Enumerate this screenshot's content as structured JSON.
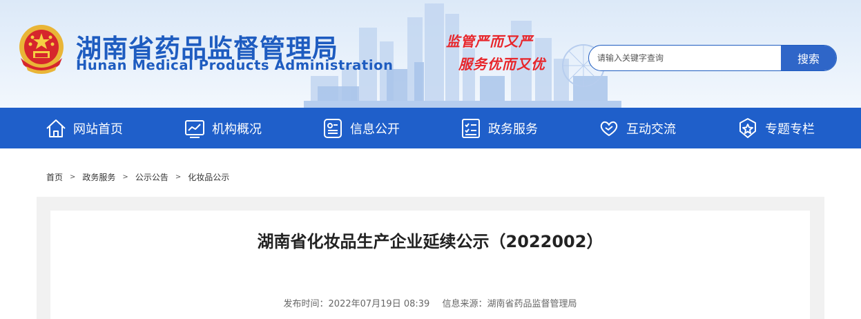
{
  "header": {
    "title_cn": "湖南省药品监督管理局",
    "title_en": "Hunan Medical Products Administration",
    "slogan_line1": "监管严而又严",
    "slogan_line2": "服务优而又优",
    "emblem_icon": "national-emblem-icon",
    "search": {
      "placeholder": "请输入关键字查询",
      "button_label": "搜索"
    },
    "colors": {
      "brand_blue": "#1e5cc0",
      "slogan_red": "#e8252a"
    }
  },
  "nav": {
    "background": "#1f5fca",
    "items": [
      {
        "label": "网站首页",
        "icon": "home-icon"
      },
      {
        "label": "机构概况",
        "icon": "chart-icon"
      },
      {
        "label": "信息公开",
        "icon": "profile-card-icon"
      },
      {
        "label": "政务服务",
        "icon": "checklist-icon"
      },
      {
        "label": "互动交流",
        "icon": "heart-hands-icon"
      },
      {
        "label": "专题专栏",
        "icon": "star-badge-icon"
      }
    ]
  },
  "breadcrumb": {
    "items": [
      "首页",
      "政务服务",
      "公示公告",
      "化妆品公示"
    ],
    "separator": ">"
  },
  "article": {
    "title": "湖南省化妆品生产企业延续公示（2022002）",
    "publish_time": "发布时间：2022年07月19日 08:39",
    "source": "信息来源：湖南省药品监督管理局"
  }
}
